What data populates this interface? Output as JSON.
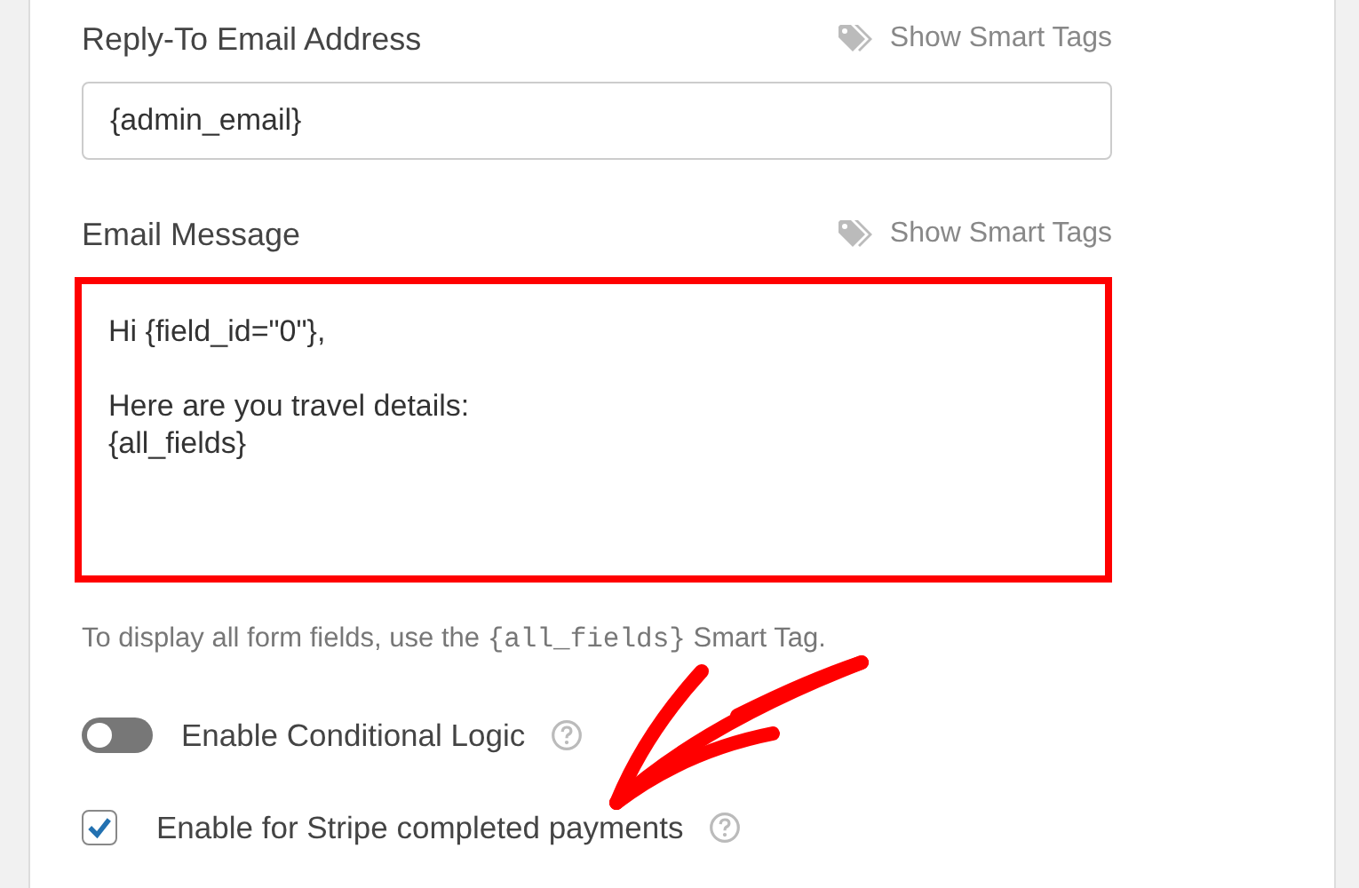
{
  "fields": [
    {
      "label": "Reply-To Email Address",
      "smart_tags": "Show Smart Tags",
      "kind": "input",
      "value": "{admin_email}",
      "highlighted": false
    },
    {
      "label": "Email Message",
      "smart_tags": "Show Smart Tags",
      "kind": "textarea",
      "paragraphs": [
        [
          "Hi {field_id=\"0\"},"
        ],
        [
          "Here are you travel details:",
          "{all_fields}"
        ]
      ],
      "highlighted": true
    }
  ],
  "help_text": [
    {
      "kind": "text",
      "text": "To display all form fields, use the "
    },
    {
      "kind": "code",
      "text": "{all_fields}"
    },
    {
      "kind": "text",
      "text": " Smart Tag."
    }
  ],
  "options": [
    {
      "kind": "toggle",
      "label": "Enable Conditional Logic",
      "on": false
    },
    {
      "kind": "checkbox",
      "label": "Enable for Stripe completed payments",
      "checked": true
    }
  ]
}
